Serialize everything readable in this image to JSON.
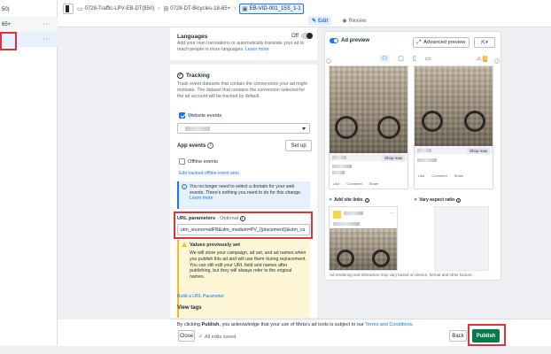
{
  "leftrail": {
    "rows": [
      {
        "label": "50)"
      },
      {
        "label": "65+"
      },
      {
        "label": ""
      }
    ],
    "more": "···"
  },
  "breadcrumbs": [
    {
      "label": "0728-Traffic-LPV-EB-DT($50)"
    },
    {
      "label": "0728-DT-Bicycles-18-65+"
    },
    {
      "label": "EB-VID-001_15S_1-1"
    }
  ],
  "modes": {
    "edit": "Edit",
    "review": "Review"
  },
  "languages": {
    "title": "Languages",
    "toggle": "Off",
    "desc": "Add your own translations or automatically translate your ad to reach people in more languages.",
    "link": "Learn more"
  },
  "tracking": {
    "title": "Tracking",
    "desc": "Track event datasets that contain the conversions your ad might motivate. The dataset that contains the conversion selected for the ad account will be tracked by default.",
    "website_events": "Website events",
    "app_events": "App events",
    "setup": "Set up",
    "offline_events": "Offline events",
    "edit_offline": "Edit tracked offline event sets",
    "info": "You no longer need to select a domain for your web events. There's nothing you need to do for this change.",
    "info_link": "Learn more",
    "url_label": "URL parameters",
    "url_optional": "· Optional",
    "url_value": "utm_source=adFB&utm_medium=PV_{{placement}}&utm_ca",
    "warn_title": "Values previously set",
    "warn_body": "We will store your campaign, ad set, and ad names when you publish this ad and will use them during replacement. You can still edit your URL field and names after publishing, but they will always refer to the original names.",
    "build_link": "Build a URL Parameter",
    "view_tags": "View tags"
  },
  "preview": {
    "title": "Ad preview",
    "advanced": "Advanced preview",
    "warn_count": "1",
    "card": {
      "shop": "Shop now",
      "like": "Like",
      "comment": "Comment",
      "share": "Share"
    },
    "label_site_links": "Add site links",
    "label_aspect": "Vary aspect ratio",
    "disclaimer": "Ad rendering and interaction may vary based on device, format and other factors."
  },
  "bottom": {
    "terms_pre": "By clicking ",
    "terms_publish": "Publish",
    "terms_mid": ", you acknowledge that your use of Meta's ad tools is subject to our ",
    "terms_link": "Terms and Conditions",
    "terms_end": ".",
    "close": "Close",
    "saved": "All edits saved",
    "back": "Back",
    "publish": "Publish"
  },
  "colors": {
    "accent": "#1877f2",
    "publish": "#077a4b",
    "highlight": "#e3313c"
  }
}
